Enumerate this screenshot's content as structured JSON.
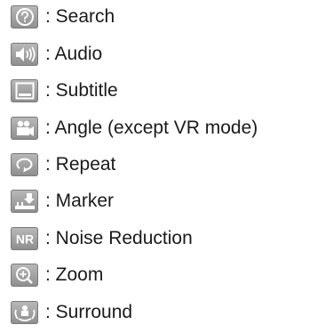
{
  "legend": {
    "items": [
      {
        "icon": "search-icon",
        "label": ": Search"
      },
      {
        "icon": "audio-icon",
        "label": ": Audio"
      },
      {
        "icon": "subtitle-icon",
        "label": ": Subtitle"
      },
      {
        "icon": "angle-icon",
        "label": ": Angle (except VR mode)"
      },
      {
        "icon": "repeat-icon",
        "label": ": Repeat"
      },
      {
        "icon": "marker-icon",
        "label": ": Marker"
      },
      {
        "icon": "noise-reduction-icon",
        "icon_text": "NR",
        "label": ": Noise Reduction"
      },
      {
        "icon": "zoom-icon",
        "label": ": Zoom"
      },
      {
        "icon": "surround-icon",
        "label": ": Surround"
      }
    ]
  }
}
